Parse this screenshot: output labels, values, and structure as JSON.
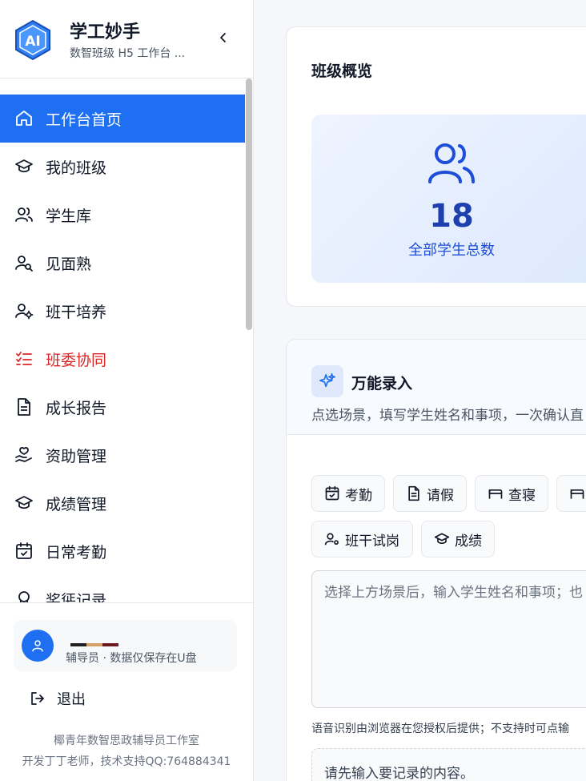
{
  "app": {
    "title": "学工妙手",
    "subtitle": "数智班级 H5 工作台 ...",
    "logo_text": "AI"
  },
  "nav": {
    "items": [
      {
        "label": "工作台首页",
        "icon": "home-icon",
        "active": true
      },
      {
        "label": "我的班级",
        "icon": "graduation-cap-icon"
      },
      {
        "label": "学生库",
        "icon": "users-icon"
      },
      {
        "label": "见面熟",
        "icon": "user-search-icon"
      },
      {
        "label": "班干培养",
        "icon": "user-cog-icon"
      },
      {
        "label": "班委协同",
        "icon": "list-checks-icon",
        "warn": true
      },
      {
        "label": "成长报告",
        "icon": "file-text-icon"
      },
      {
        "label": "资助管理",
        "icon": "hand-heart-icon"
      },
      {
        "label": "成绩管理",
        "icon": "graduation-cap-icon"
      },
      {
        "label": "日常考勤",
        "icon": "calendar-check-icon"
      },
      {
        "label": "奖惩记录",
        "icon": "award-icon"
      }
    ]
  },
  "user": {
    "role": "辅导员 · 数据仅保存在U盘",
    "logout_label": "退出"
  },
  "footer": {
    "line1": "椰青年数智思政辅导员工作室",
    "line2": "开发丁丁老师，技术支持QQ:764884341"
  },
  "overview": {
    "title": "班级概览",
    "total_students": "18",
    "total_label": "全部学生总数"
  },
  "quick_entry": {
    "title": "万能录入",
    "description": "点选场景，填写学生姓名和事项，一次确认直",
    "chips": [
      {
        "label": "考勤",
        "icon": "calendar-check-icon"
      },
      {
        "label": "请假",
        "icon": "file-text-icon"
      },
      {
        "label": "查寝",
        "icon": "bed-icon"
      },
      {
        "label": "",
        "icon": "bed-icon"
      },
      {
        "label": "班干试岗",
        "icon": "user-cog-icon"
      },
      {
        "label": "成绩",
        "icon": "graduation-cap-icon"
      }
    ],
    "textarea_placeholder": "选择上方场景后，输入学生姓名和事项；也",
    "voice_hint": "语音识别由浏览器在您授权后提供；不支持时可点输",
    "second_input_placeholder": "请先输入要记录的内容。"
  },
  "colors": {
    "accent": "#1f6ff2",
    "warn": "#dc2626",
    "stat_text": "#1e40af"
  }
}
